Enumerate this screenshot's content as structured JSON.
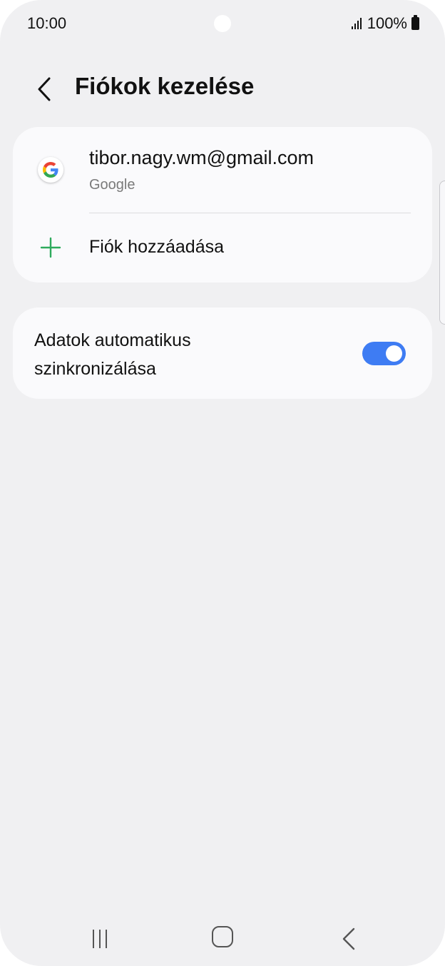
{
  "status_bar": {
    "time": "10:00",
    "battery": "100%",
    "icons": [
      "signal-icon",
      "battery-icon"
    ]
  },
  "header": {
    "title": "Fiókok kezelése",
    "back_icon": "chevron-left-icon"
  },
  "accounts": [
    {
      "email": "tibor.nagy.wm@gmail.com",
      "provider": "Google",
      "icon": "google-icon"
    }
  ],
  "add_account": {
    "label": "Fiók hozzáadása",
    "icon": "plus-icon"
  },
  "sync": {
    "label": "Adatok automatikus szinkronizálása",
    "enabled": true
  },
  "nav_bar": {
    "icons": [
      "recent-apps-icon",
      "home-icon",
      "back-icon"
    ]
  },
  "colors": {
    "background": "#f0f0f2",
    "card": "#fafafc",
    "accent": "#3e7cf3",
    "plus": "#2eaa5c"
  }
}
